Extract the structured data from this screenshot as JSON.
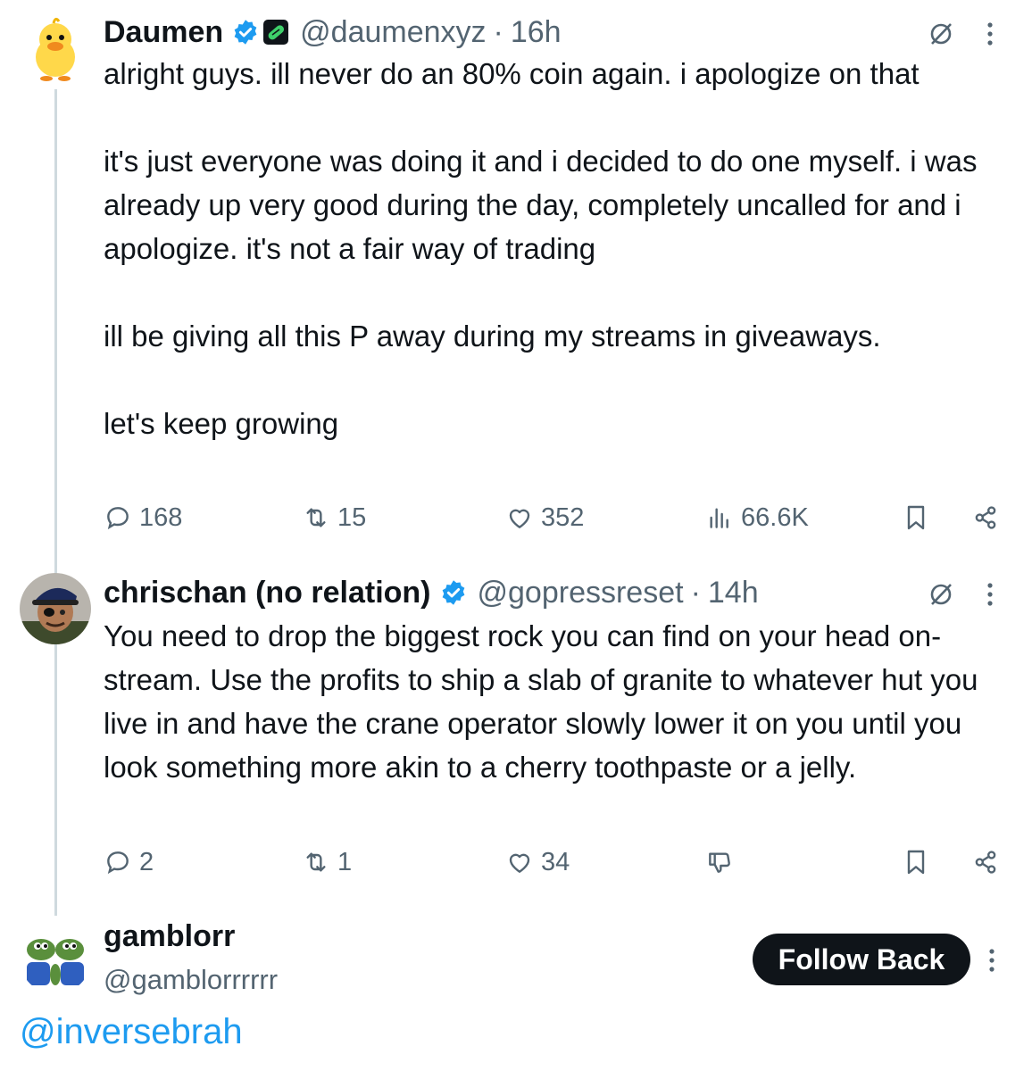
{
  "tweets": [
    {
      "name": "Daumen",
      "handle": "@daumenxyz",
      "separator": "·",
      "time": "16h",
      "paragraphs": [
        "alright guys. ill never do an 80% coin again. i apologize on that",
        "it's just everyone was doing it and i decided to do one myself. i was already up very good during the day, completely uncalled for and i apologize. it's not a fair way of trading",
        "ill be giving all this P away during my streams in giveaways.",
        "let's keep growing"
      ],
      "replies": "168",
      "reposts": "15",
      "likes": "352",
      "views": "66.6K"
    },
    {
      "name": "chrischan (no relation)",
      "handle": "@gopressreset",
      "separator": "·",
      "time": "14h",
      "paragraphs": [
        "You need to drop the biggest rock you can find on your head on-stream. Use the profits to ship a slab of granite to whatever hut you live in and have the crane operator slowly lower it on you until you look something more akin to a cherry toothpaste or a jelly."
      ],
      "replies": "2",
      "reposts": "1",
      "likes": "34"
    }
  ],
  "reply": {
    "name": "gamblorr",
    "handle": "@gamblorrrrrr",
    "follow_label": "Follow Back",
    "text": "@inversebrah"
  },
  "colors": {
    "text": "#0f1419",
    "secondary": "#536471",
    "accent": "#1d9bf0",
    "thread_line": "#cfd9de"
  }
}
